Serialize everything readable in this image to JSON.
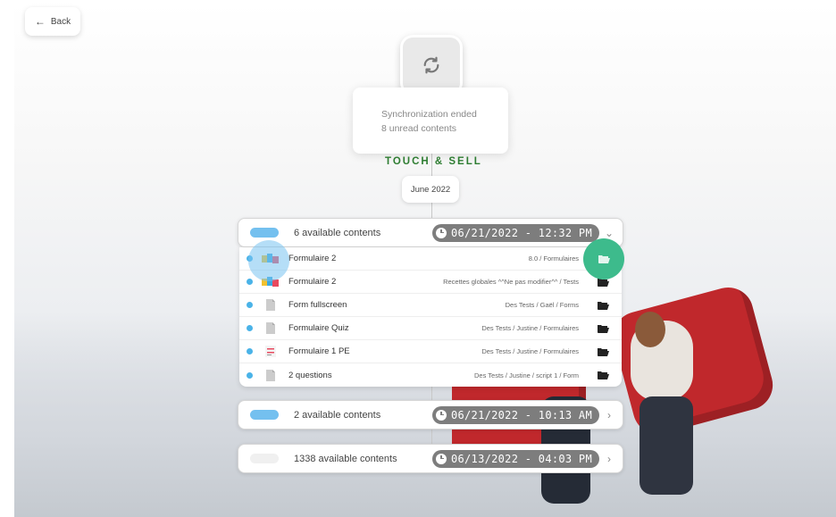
{
  "back": {
    "label": "Back"
  },
  "sync": {
    "status": "Synchronization ended",
    "unread": "8 unread contents"
  },
  "brand": {
    "text": "TOUCH & SELL"
  },
  "date_chip": "June 2022",
  "groups": [
    {
      "label": "6 available contents",
      "time": "06/21/2022 - 12:32 PM",
      "pill_color": "#74c0ef",
      "expanded": true
    },
    {
      "label": "2 available contents",
      "time": "06/21/2022 - 10:13 AM",
      "pill_color": "#74c0ef",
      "expanded": false
    },
    {
      "label": "1338 available contents",
      "time": "06/13/2022 - 04:03 PM",
      "pill_color": "#f0f0f0",
      "expanded": false
    }
  ],
  "items": [
    {
      "title": "Formulaire 2",
      "path": "8.0 / Formulaires",
      "icon": "form-color-icon"
    },
    {
      "title": "Formulaire 2",
      "path": "Recettes globales ^^Ne pas modifier^^ / Tests",
      "icon": "form-color-icon"
    },
    {
      "title": "Form fullscreen",
      "path": "Des Tests / Gaël / Forms",
      "icon": "document-icon"
    },
    {
      "title": "Formulaire Quiz",
      "path": "Des Tests / Justine / Formulaires",
      "icon": "document-icon"
    },
    {
      "title": "Formulaire 1 PE",
      "path": "Des Tests / Justine / Formulaires",
      "icon": "chart-doc-icon"
    },
    {
      "title": "2 questions",
      "path": "Des Tests / Justine / script 1 / Form",
      "icon": "document-icon"
    }
  ],
  "colors": {
    "accent_blue": "#4ab3e8",
    "brand_green": "#2e7d32",
    "folder_highlight": "#3dbb8c",
    "badge_gray": "#7d7d7d"
  }
}
